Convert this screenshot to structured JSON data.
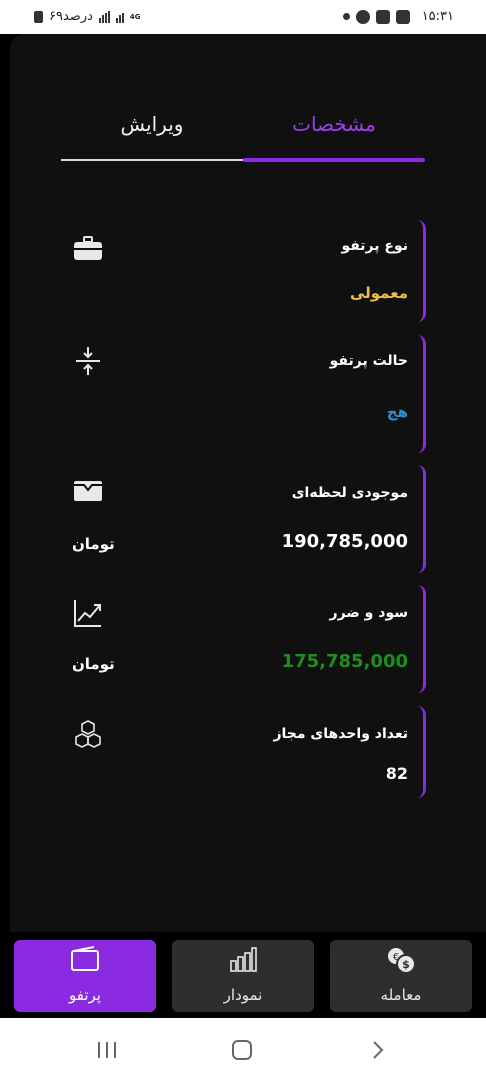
{
  "statusbar": {
    "time": "۱۵:۳۱",
    "battery": "۶۹درصد",
    "network": "4G"
  },
  "tabs": {
    "active_label": "مشخصات",
    "edit_label": "ویرایش"
  },
  "cards": [
    {
      "label": "نوع پرتفو",
      "value": "معمولی",
      "value_color": "#f0c040",
      "icon": "briefcase-icon"
    },
    {
      "label": "حالت پرتفو",
      "value": "هج",
      "value_color": "#2f8fd0",
      "icon": "compress-vertical-icon"
    },
    {
      "label": "موجودی لحظه‌ای",
      "value": "190,785,000",
      "unit": "تومان",
      "value_color": "#ffffff",
      "icon": "wallet-icon"
    },
    {
      "label": "سود و ضرر",
      "value": "175,785,000",
      "unit": "تومان",
      "value_color": "#1e8f1e",
      "icon": "trending-up-icon"
    },
    {
      "label": "تعداد واحدهای مجاز",
      "value": "82",
      "value_color": "#ffffff",
      "icon": "cubes-icon"
    }
  ],
  "nav": {
    "portfolio_label": "پرتفو",
    "chart_label": "نمودار",
    "trade_label": "معامله"
  },
  "colors": {
    "accent": "#8a2be2",
    "tab_active": "#9b3ff0"
  }
}
